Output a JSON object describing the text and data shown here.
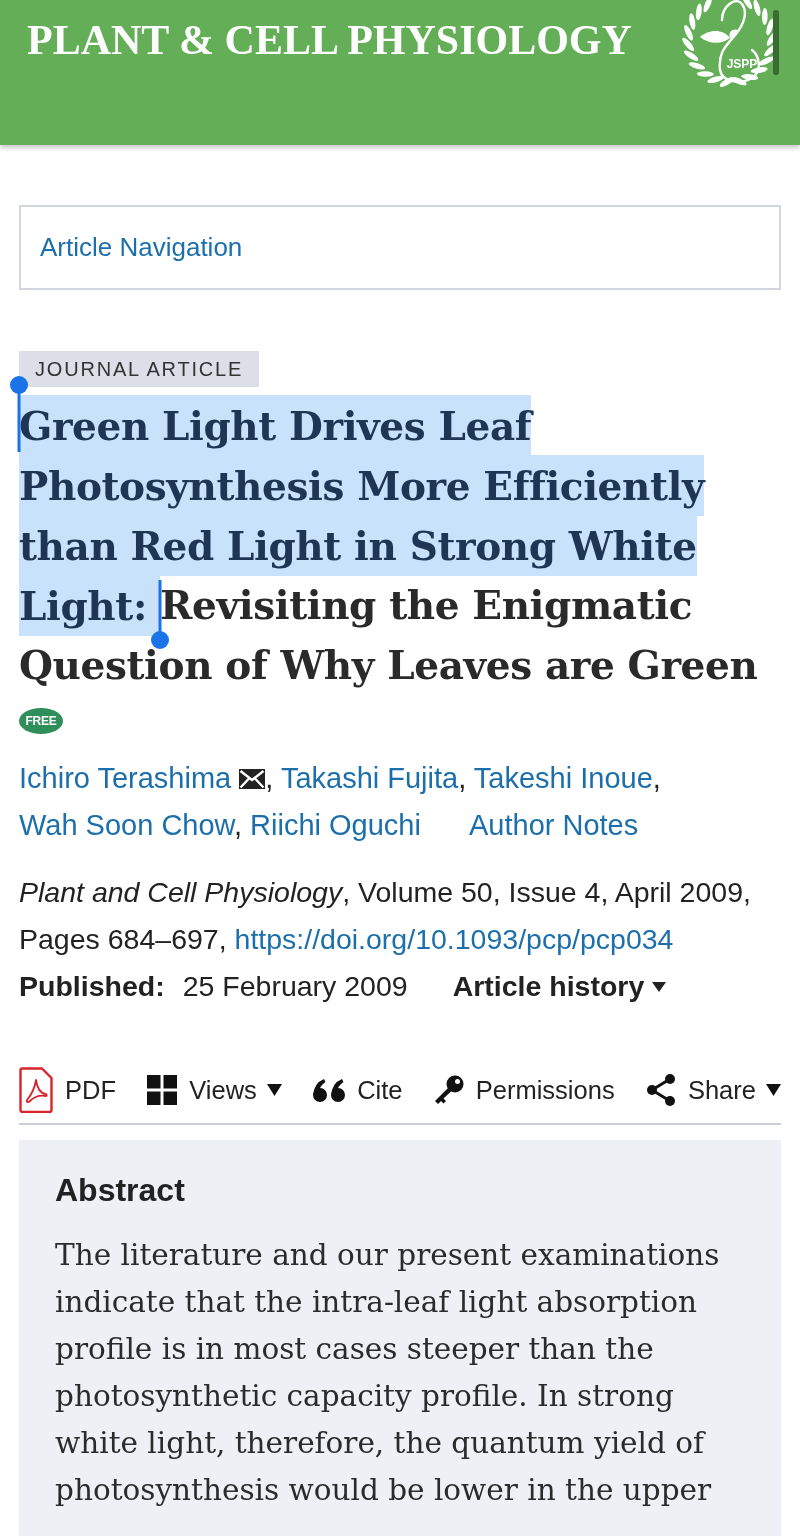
{
  "header": {
    "title": "PLANT & CELL PHYSIOLOGY",
    "logo_text": "JSPP"
  },
  "article_navigation": {
    "label": "Article Navigation"
  },
  "article": {
    "type_label": "JOURNAL ARTICLE",
    "title_segments": [
      {
        "text": "Green Light Drives Leaf Photosynthesis More Efficiently than Red Light in Strong White Light: ",
        "selected": true
      },
      {
        "text": "Revisiting the Enigmatic Question of Why Leaves are Green",
        "selected": false
      }
    ],
    "access_badge": "FREE",
    "authors": [
      {
        "name": "Ichiro Terashima",
        "corresponding": true,
        "separator": ","
      },
      {
        "name": "Takashi Fujita",
        "corresponding": false,
        "separator": ","
      },
      {
        "name": "Takeshi Inoue",
        "corresponding": false,
        "separator": ","
      },
      {
        "name": "Wah Soon Chow",
        "corresponding": false,
        "separator": ","
      },
      {
        "name": "Riichi Oguchi",
        "corresponding": false
      }
    ],
    "author_notes": "Author Notes",
    "citation": "*Plant and Cell Physiology*, Volume 50, Issue 4, April 2009, Pages 684–697,",
    "doi": "https://doi.org/10.1093/pcp/pcp034",
    "published_label": "Published:",
    "published_date": "25 February 2009",
    "history_label": "Article history"
  },
  "tools": [
    {
      "label": "PDF",
      "dropdown": false
    },
    {
      "label": "Views",
      "dropdown": true
    },
    {
      "label": "Cite",
      "dropdown": false
    },
    {
      "label": "Permissions",
      "dropdown": false
    },
    {
      "label": "Share",
      "dropdown": true
    }
  ],
  "abstract": {
    "heading": "Abstract",
    "text": "The literature and our present examinations indicate that the intra-leaf light absorption profile is in most cases steeper than the photosynthetic capacity profile. In strong white light, therefore, the quantum yield of photosynthesis would be lower in the upper"
  }
}
